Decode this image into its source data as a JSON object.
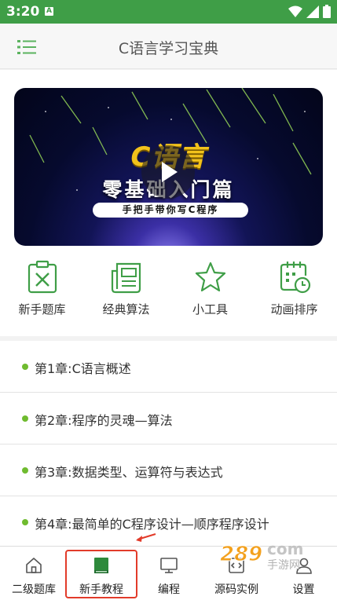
{
  "status_bar": {
    "time": "3:20",
    "notification_badge": "A"
  },
  "toolbar": {
    "title": "C语言学习宝典",
    "menu_icon": "list-menu-icon"
  },
  "banner": {
    "logo_text": "C语言",
    "title": "零基础入门篇",
    "subtitle": "手把手带你写C程序"
  },
  "features": [
    {
      "label": "新手题库",
      "icon": "quiz-icon"
    },
    {
      "label": "经典算法",
      "icon": "newspaper-icon"
    },
    {
      "label": "小工具",
      "icon": "star-icon"
    },
    {
      "label": "动画排序",
      "icon": "calendar-clock-icon"
    }
  ],
  "chapters": [
    {
      "label": "第1章:C语言概述"
    },
    {
      "label": "第2章:程序的灵魂—算法"
    },
    {
      "label": "第3章:数据类型、运算符与表达式"
    },
    {
      "label": "第4章:最简单的C程序设计—顺序程序设计"
    }
  ],
  "bottom_nav": [
    {
      "label": "二级题库",
      "icon": "home-icon"
    },
    {
      "label": "新手教程",
      "icon": "book-icon",
      "active": true
    },
    {
      "label": "编程",
      "icon": "monitor-icon"
    },
    {
      "label": "源码实例",
      "icon": "code-icon"
    },
    {
      "label": "设置",
      "icon": "user-icon"
    }
  ],
  "watermark": {
    "brand": "289",
    "suffix": "com",
    "tag": "手游网"
  },
  "colors": {
    "accent": "#3f9e47",
    "dot": "#6fbb2f",
    "highlight": "#e23b2a",
    "text": "#333333"
  }
}
